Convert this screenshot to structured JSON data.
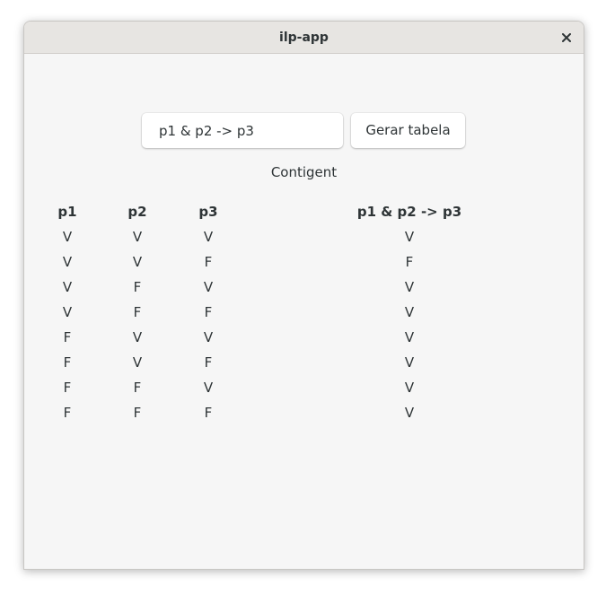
{
  "window": {
    "title": "ilp-app",
    "close_icon": "close-icon"
  },
  "form": {
    "formula_value": "p1 & p2 -> p3",
    "generate_label": "Gerar tabela"
  },
  "result": {
    "classification": "Contigent"
  },
  "table": {
    "headers": [
      "p1",
      "p2",
      "p3",
      "p1 & p2 -> p3"
    ],
    "rows": [
      [
        "V",
        "V",
        "V",
        "V"
      ],
      [
        "V",
        "V",
        "F",
        "F"
      ],
      [
        "V",
        "F",
        "V",
        "V"
      ],
      [
        "V",
        "F",
        "F",
        "V"
      ],
      [
        "F",
        "V",
        "V",
        "V"
      ],
      [
        "F",
        "V",
        "F",
        "V"
      ],
      [
        "F",
        "F",
        "V",
        "V"
      ],
      [
        "F",
        "F",
        "F",
        "V"
      ]
    ]
  }
}
